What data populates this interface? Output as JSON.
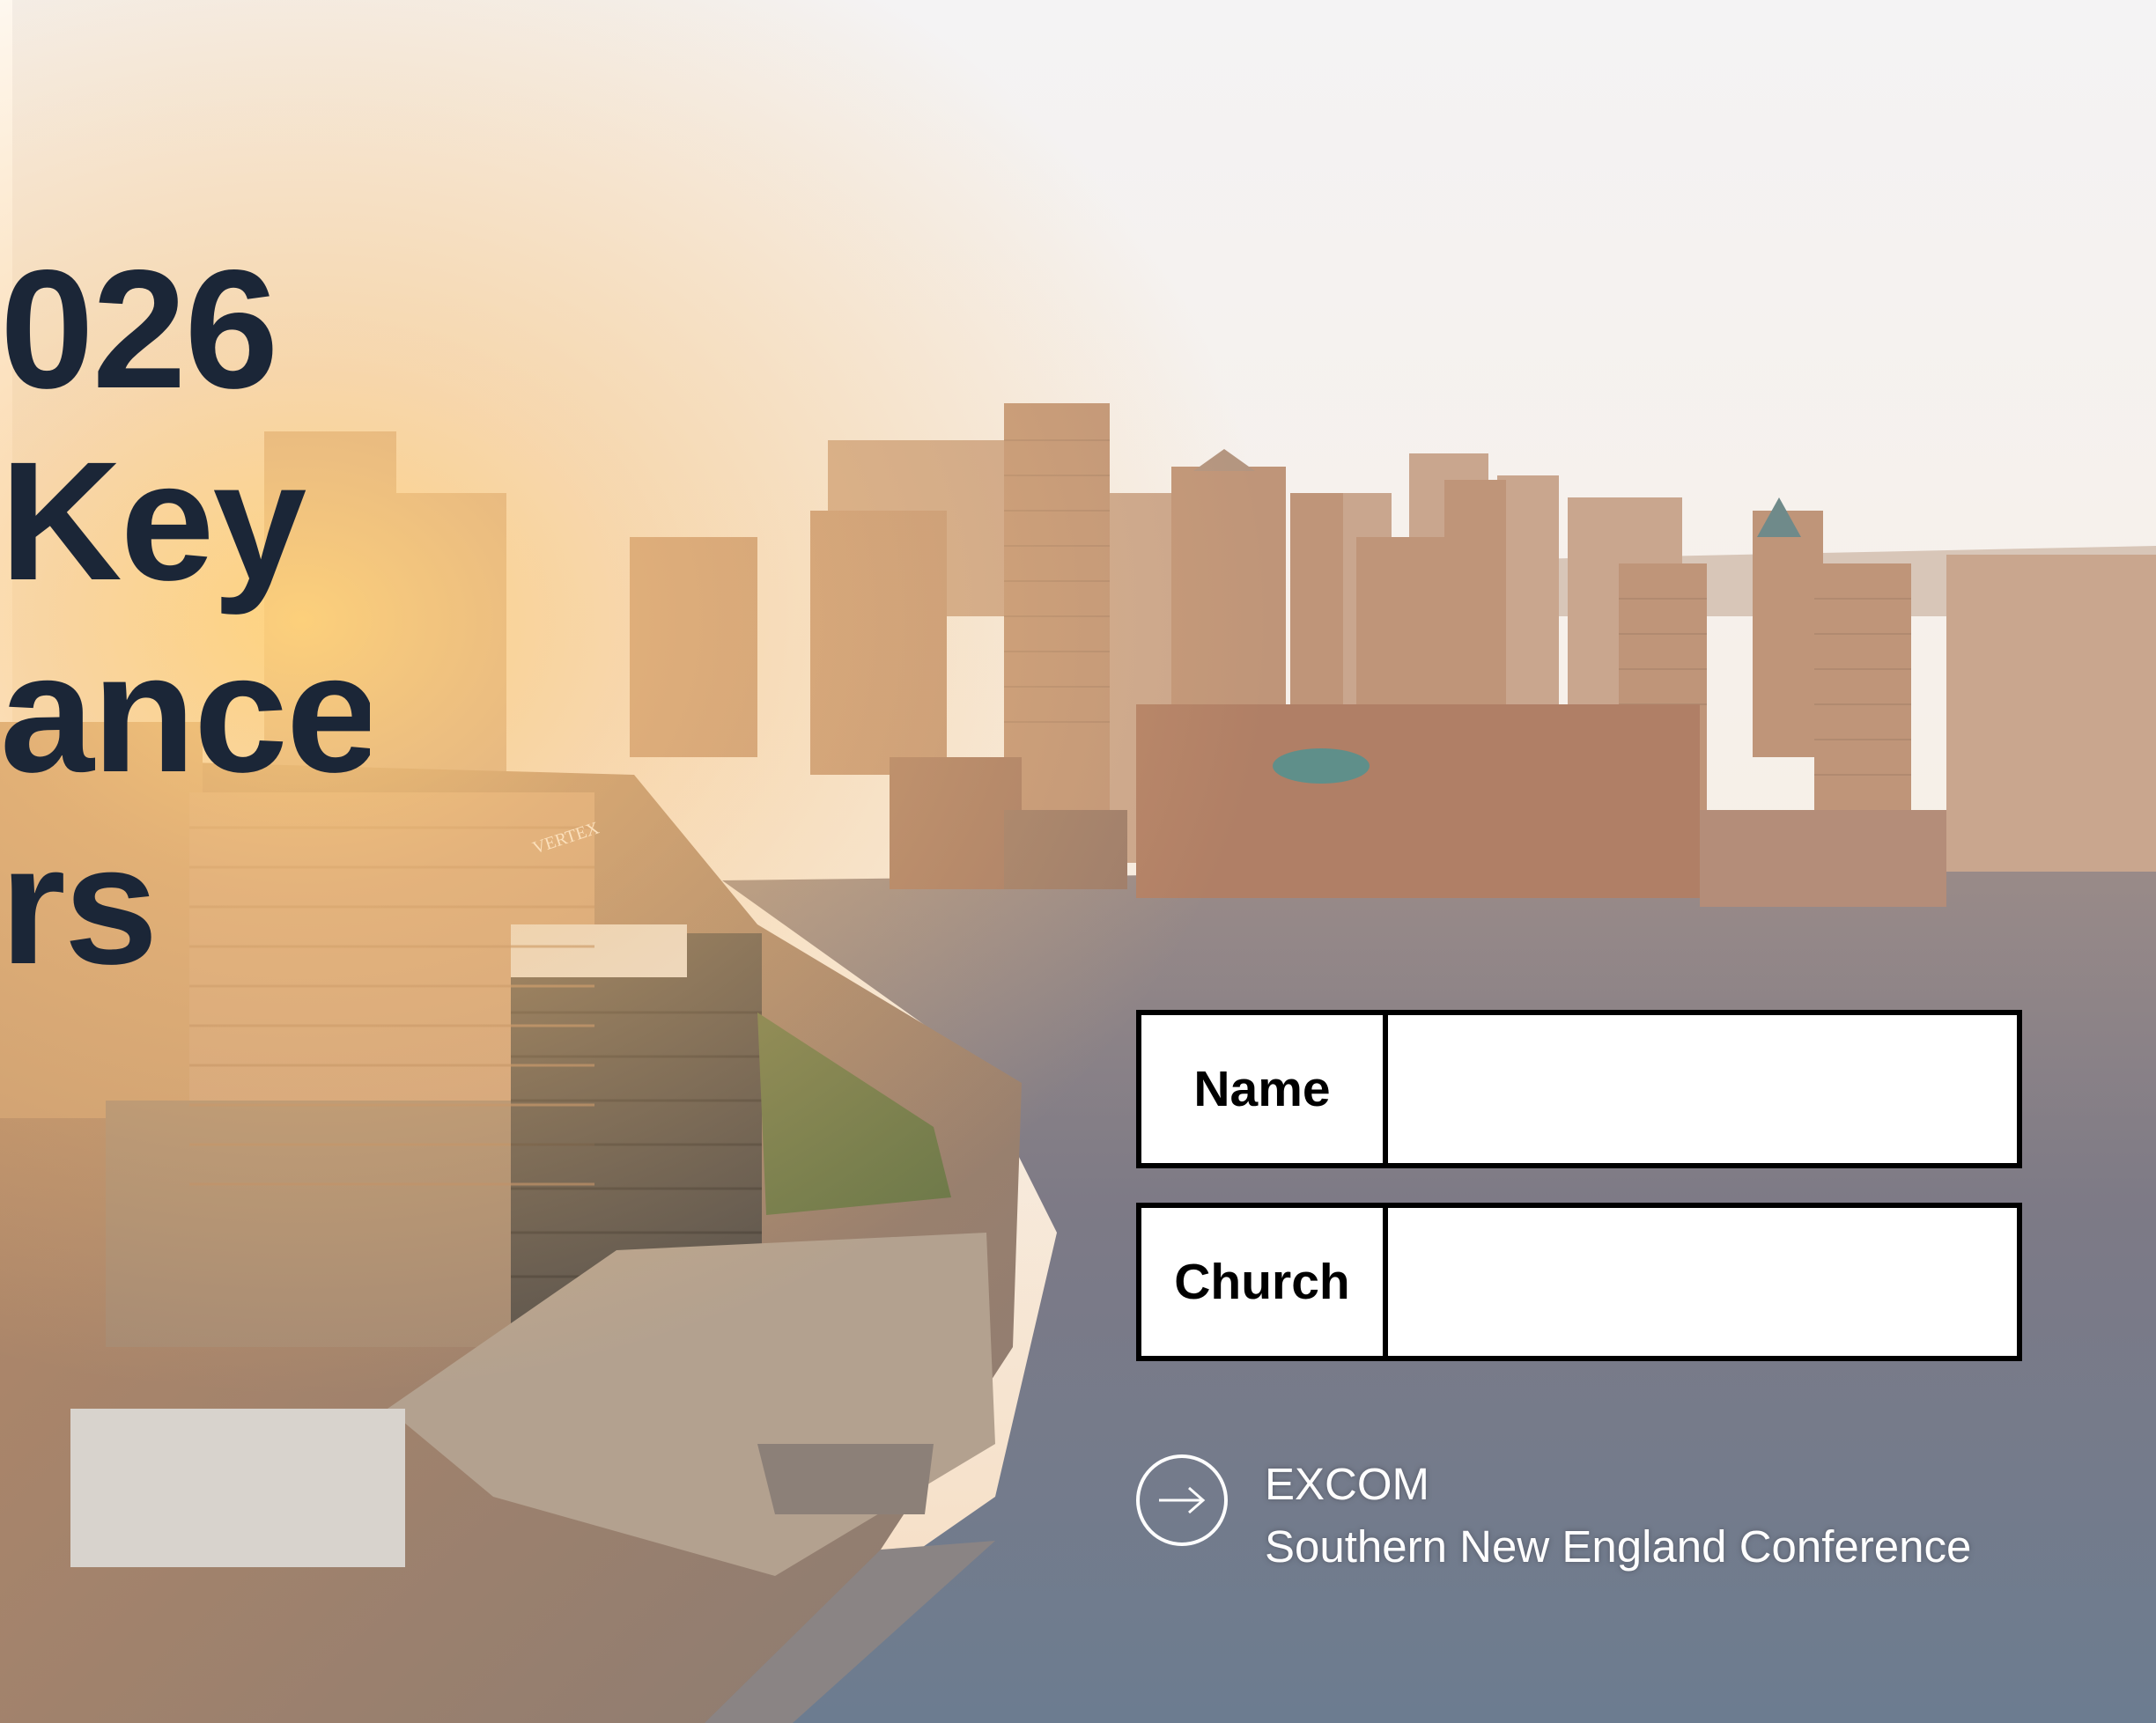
{
  "headline": {
    "line1": "026",
    "line2": "Key",
    "line3": "ance",
    "line4": "rs"
  },
  "form": {
    "name_label": "Name",
    "name_value": "",
    "church_label": "Church",
    "church_value": ""
  },
  "footer": {
    "org_short": "EXCOM",
    "org_full": "Southern New England Conference"
  },
  "photo": {
    "building_sign": "VERTEX"
  },
  "icons": {
    "footer_icon": "arrow-right-circle-icon"
  },
  "colors": {
    "headline_text": "#1b2637",
    "form_border": "#000000",
    "footer_text": "#ffffff"
  }
}
